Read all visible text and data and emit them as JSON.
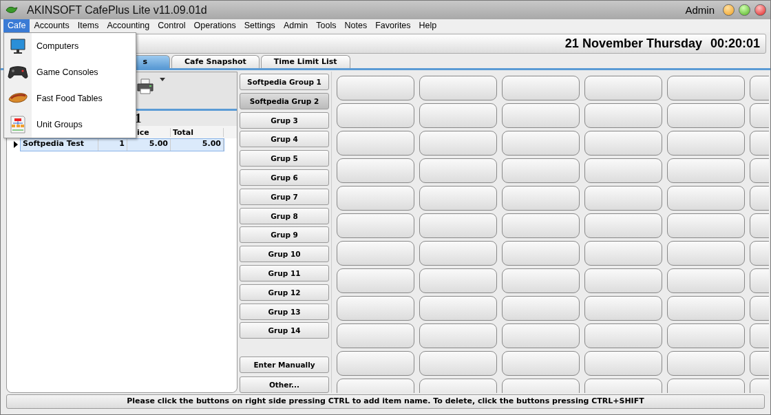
{
  "window": {
    "title": "AKINSOFT CafePlus Lite v11.09.01d",
    "user": "Admin"
  },
  "menu_bar": [
    {
      "label": "Cafe",
      "selected": true
    },
    {
      "label": "Accounts",
      "selected": false
    },
    {
      "label": "Items",
      "selected": false
    },
    {
      "label": "Accounting",
      "selected": false
    },
    {
      "label": "Control",
      "selected": false
    },
    {
      "label": "Operations",
      "selected": false
    },
    {
      "label": "Settings",
      "selected": false
    },
    {
      "label": "Admin",
      "selected": false
    },
    {
      "label": "Tools",
      "selected": false
    },
    {
      "label": "Notes",
      "selected": false
    },
    {
      "label": "Favorites",
      "selected": false
    },
    {
      "label": "Help",
      "selected": false
    }
  ],
  "cafe_menu": [
    {
      "label": "Computers",
      "kind": "computer"
    },
    {
      "label": "Game Consoles",
      "kind": "gamepad"
    },
    {
      "label": "Fast Food Tables",
      "kind": "food"
    },
    {
      "label": "Unit Groups",
      "kind": "chart"
    }
  ],
  "date_time": {
    "date": "21 November Thursday",
    "time": "00:20:01"
  },
  "tabs": [
    {
      "label": "s",
      "selected": true
    },
    {
      "label": "Cafe Snapshot",
      "selected": false
    },
    {
      "label": "Time Limit List",
      "selected": false
    }
  ],
  "order": {
    "heading": "1",
    "columns": [
      "",
      "",
      "ice",
      "Total"
    ],
    "rows": [
      {
        "cells": [
          "Softpedia Test",
          "1",
          "5.00",
          "5.00"
        ],
        "selected": true
      }
    ]
  },
  "groups": [
    {
      "label": "Softpedia Group 1",
      "selected": false
    },
    {
      "label": "Softpedia Grup 2",
      "selected": true
    },
    {
      "label": "Grup 3",
      "selected": false
    },
    {
      "label": "Grup 4",
      "selected": false
    },
    {
      "label": "Grup 5",
      "selected": false
    },
    {
      "label": "Grup 6",
      "selected": false
    },
    {
      "label": "Grup 7",
      "selected": false
    },
    {
      "label": "Grup 8",
      "selected": false
    },
    {
      "label": "Grup 9",
      "selected": false
    },
    {
      "label": "Grup 10",
      "selected": false
    },
    {
      "label": "Grup 11",
      "selected": false
    },
    {
      "label": "Grup 12",
      "selected": false
    },
    {
      "label": "Grup 13",
      "selected": false
    },
    {
      "label": "Grup 14",
      "selected": false
    }
  ],
  "actions": [
    "Enter Manually",
    "Other..."
  ],
  "status_bar": "Please click the buttons on right side pressing CTRL to add item name. To delete, click the buttons pressing CTRL+SHIFT"
}
